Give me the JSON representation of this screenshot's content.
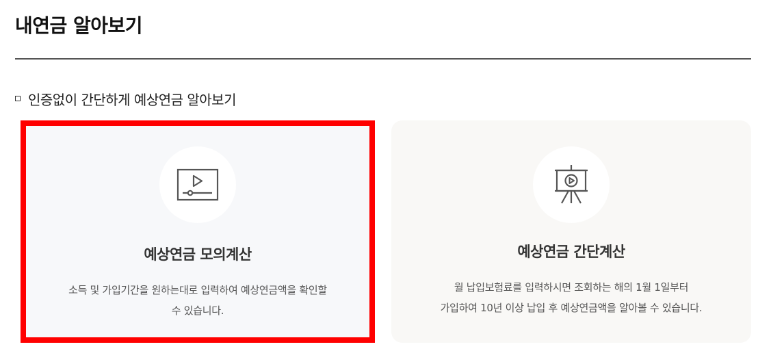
{
  "page": {
    "title": "내연금 알아보기"
  },
  "section": {
    "heading": "인증없이 간단하게 예상연금 알아보기"
  },
  "cards": [
    {
      "icon": "video-player-icon",
      "title": "예상연금 모의계산",
      "description_lines": [
        "소득 및 가입기간을 원하는대로 입력하여 예상연금액을 확인할",
        "수 있습니다."
      ],
      "selected": true
    },
    {
      "icon": "presentation-board-icon",
      "title": "예상연금 간단계산",
      "description_lines": [
        "월 납입보험료를 입력하시면 조회하는 해의 1월 1일부터",
        "가입하여 10년 이상 납입 후 예상연금액을 알아볼 수 있습니다."
      ],
      "selected": false
    }
  ],
  "colors": {
    "highlight_border": "#ff0000",
    "card1_background": "#f7f8fa",
    "card2_background": "#f9f8f6",
    "icon_stroke": "#555555"
  }
}
